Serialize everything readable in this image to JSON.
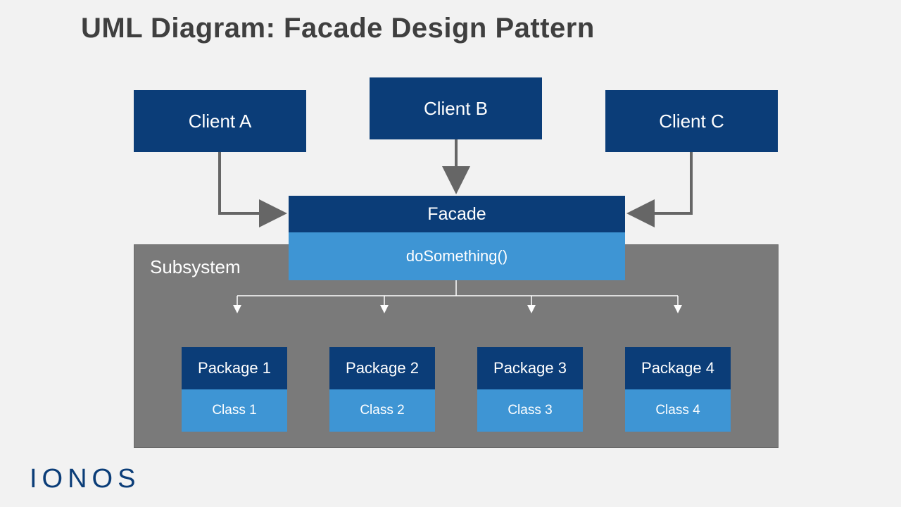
{
  "title": "UML Diagram: Facade Design Pattern",
  "clients": {
    "a": "Client A",
    "b": "Client B",
    "c": "Client C"
  },
  "facade": {
    "name": "Facade",
    "method": "doSomething()"
  },
  "subsystem": {
    "label": "Subsystem",
    "packages": [
      {
        "name": "Package 1",
        "class": "Class 1"
      },
      {
        "name": "Package 2",
        "class": "Class 2"
      },
      {
        "name": "Package 3",
        "class": "Class 3"
      },
      {
        "name": "Package 4",
        "class": "Class 4"
      }
    ]
  },
  "logo": "IONOS"
}
